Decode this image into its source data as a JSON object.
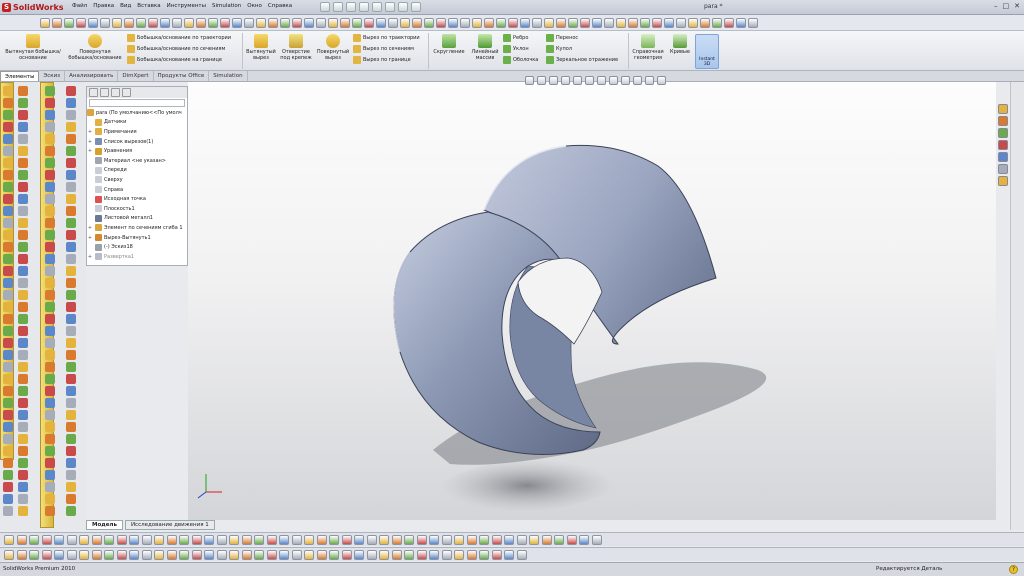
{
  "app": {
    "title": "SolidWorks",
    "document_title": "para *",
    "status_left": "SolidWorks Premium 2010",
    "status_right": "Редактируется Деталь",
    "help_glyph": "?"
  },
  "menu": [
    "Файл",
    "Правка",
    "Вид",
    "Вставка",
    "Инструменты",
    "Simulation",
    "Окно",
    "Справка"
  ],
  "window_buttons": [
    "–",
    "□",
    "✕"
  ],
  "commands": {
    "extrude_boss": "Вытянутая бобышка/основание",
    "revolve_boss": "Повернутая бобышка/основание",
    "swept_boss": "Бобышка/основание по траектории",
    "loft_boss": "Бобышка/основание по сечениям",
    "boundary_boss": "Бобышка/основание на границе",
    "extrude_cut": "Вытянутый вырез",
    "hole_wizard": "Отверстие под крепеж",
    "revolve_cut": "Повернутый вырез",
    "swept_cut": "Вырез по траектории",
    "loft_cut": "Вырез по сечениям",
    "boundary_cut": "Вырез по границе",
    "fillet": "Скругление",
    "linear_pattern": "Линейный массив",
    "rib": "Ребро",
    "draft": "Уклон",
    "shell": "Оболочка",
    "wrap": "Перенос",
    "dome": "Купол",
    "mirror": "Зеркальное отражение",
    "ref_geometry": "Справочная геометрия",
    "curves": "Кривые",
    "instant3d": "Instant 3D"
  },
  "tabs": [
    "Элементы",
    "Эскиз",
    "Анализировать",
    "DimXpert",
    "Продукты Office",
    "Simulation"
  ],
  "tree": {
    "root": "para  (По умолчанию<<По умолч",
    "items": [
      {
        "label": "Датчики",
        "exp": "",
        "color": "#e0b040"
      },
      {
        "label": "Примечания",
        "exp": "+",
        "color": "#e0b040"
      },
      {
        "label": "Список вырезов(1)",
        "exp": "+",
        "color": "#7a8fb0"
      },
      {
        "label": "Уравнения",
        "exp": "+",
        "color": "#d6a12a"
      },
      {
        "label": "Материал <не указан>",
        "exp": "",
        "color": "#9fa6b2"
      },
      {
        "label": "Спереди",
        "exp": "",
        "color": "#c9cdd6"
      },
      {
        "label": "Сверху",
        "exp": "",
        "color": "#c9cdd6"
      },
      {
        "label": "Справа",
        "exp": "",
        "color": "#c9cdd6"
      },
      {
        "label": "Исходная точка",
        "exp": "",
        "color": "#e05050"
      },
      {
        "label": "Плоскость1",
        "exp": "",
        "color": "#c9cdd6"
      },
      {
        "label": "Листовой металл1",
        "exp": "",
        "color": "#6a7890"
      },
      {
        "label": "Элемент по сечениям сгиба 1",
        "exp": "+",
        "color": "#d9a640"
      },
      {
        "label": "Вырез-Вытянуть1",
        "exp": "+",
        "color": "#d28a2c"
      },
      {
        "label": "(-) Эскиз18",
        "exp": "",
        "color": "#9aa0ac"
      },
      {
        "label": "Развертка1",
        "exp": "+",
        "color": "#b8bcc6",
        "dim": true
      }
    ]
  },
  "bottom_tabs": [
    "Модель",
    "Исследование движения 1"
  ],
  "colors": {
    "part_body": "#8e9ab5",
    "part_edge": "#3a4256",
    "accent": "#1c5fb0"
  }
}
